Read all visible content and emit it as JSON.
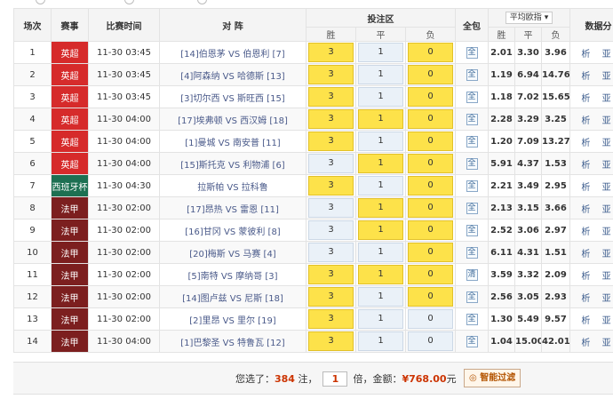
{
  "colors": {
    "epl": "#d62b2b",
    "copa": "#1d7052",
    "ligue1": "#7c1f1f",
    "selected": "#fde24a"
  },
  "header": {
    "col_no": "场次",
    "col_league": "赛事",
    "col_time": "比赛时间",
    "col_match": "对 阵",
    "col_bet": "投注区",
    "col_all": "全包",
    "col_odds": "平均欧指",
    "col_data": "数据分",
    "sub": [
      "胜",
      "平",
      "负",
      "胜",
      "平",
      "负"
    ]
  },
  "rows": [
    {
      "no": "1",
      "league": "英超",
      "lc": "epl",
      "time": "11-30 03:45",
      "home": "[14]伯恩茅",
      "away": "伯恩利 [7]",
      "w": "3",
      "d": "1",
      "l": "0",
      "sel": [
        1,
        0,
        1
      ],
      "pk": "全",
      "o": [
        "2.01",
        "3.30",
        "3.96"
      ],
      "links": "析 亚 "
    },
    {
      "no": "2",
      "league": "英超",
      "lc": "epl",
      "time": "11-30 03:45",
      "home": "[4]阿森纳",
      "away": "哈德斯 [13]",
      "w": "3",
      "d": "1",
      "l": "0",
      "sel": [
        1,
        0,
        1
      ],
      "pk": "全",
      "o": [
        "1.19",
        "6.94",
        "14.76"
      ],
      "links": "析 亚 "
    },
    {
      "no": "3",
      "league": "英超",
      "lc": "epl",
      "time": "11-30 03:45",
      "home": "[3]切尔西",
      "away": "斯旺西 [15]",
      "w": "3",
      "d": "1",
      "l": "0",
      "sel": [
        1,
        0,
        1
      ],
      "pk": "全",
      "o": [
        "1.18",
        "7.02",
        "15.65"
      ],
      "links": "析 亚 "
    },
    {
      "no": "4",
      "league": "英超",
      "lc": "epl",
      "time": "11-30 04:00",
      "home": "[17]埃弗顿",
      "away": "西汉姆 [18]",
      "w": "3",
      "d": "1",
      "l": "0",
      "sel": [
        1,
        1,
        1
      ],
      "pk": "全",
      "o": [
        "2.28",
        "3.29",
        "3.25"
      ],
      "links": "析 亚 "
    },
    {
      "no": "5",
      "league": "英超",
      "lc": "epl",
      "time": "11-30 04:00",
      "home": "[1]曼城",
      "away": "南安普 [11]",
      "w": "3",
      "d": "1",
      "l": "0",
      "sel": [
        1,
        0,
        1
      ],
      "pk": "全",
      "o": [
        "1.20",
        "7.09",
        "13.27"
      ],
      "links": "析 亚 "
    },
    {
      "no": "6",
      "league": "英超",
      "lc": "epl",
      "time": "11-30 04:00",
      "home": "[15]斯托克",
      "away": "利物浦 [6]",
      "w": "3",
      "d": "1",
      "l": "0",
      "sel": [
        0,
        1,
        1
      ],
      "pk": "全",
      "o": [
        "5.91",
        "4.37",
        "1.53"
      ],
      "links": "析 亚 "
    },
    {
      "no": "7",
      "league": "西班牙杯",
      "lc": "copa",
      "time": "11-30 04:30",
      "home": "拉斯帕",
      "away": "拉科鲁",
      "w": "3",
      "d": "1",
      "l": "0",
      "sel": [
        1,
        0,
        1
      ],
      "pk": "全",
      "o": [
        "2.21",
        "3.49",
        "2.95"
      ],
      "links": "析 亚 "
    },
    {
      "no": "8",
      "league": "法甲",
      "lc": "ligue1",
      "time": "11-30 02:00",
      "home": "[17]昂热",
      "away": "雷恩 [11]",
      "w": "3",
      "d": "1",
      "l": "0",
      "sel": [
        0,
        1,
        1
      ],
      "pk": "全",
      "o": [
        "2.13",
        "3.15",
        "3.66"
      ],
      "links": "析 亚 "
    },
    {
      "no": "9",
      "league": "法甲",
      "lc": "ligue1",
      "time": "11-30 02:00",
      "home": "[16]甘冈",
      "away": "蒙彼利 [8]",
      "w": "3",
      "d": "1",
      "l": "0",
      "sel": [
        0,
        1,
        1
      ],
      "pk": "全",
      "o": [
        "2.52",
        "3.06",
        "2.97"
      ],
      "links": "析 亚 "
    },
    {
      "no": "10",
      "league": "法甲",
      "lc": "ligue1",
      "time": "11-30 02:00",
      "home": "[20]梅斯",
      "away": "马赛 [4]",
      "w": "3",
      "d": "1",
      "l": "0",
      "sel": [
        0,
        0,
        1
      ],
      "pk": "全",
      "o": [
        "6.11",
        "4.31",
        "1.51"
      ],
      "links": "析 亚 "
    },
    {
      "no": "11",
      "league": "法甲",
      "lc": "ligue1",
      "time": "11-30 02:00",
      "home": "[5]南特",
      "away": "摩纳哥 [3]",
      "w": "3",
      "d": "1",
      "l": "0",
      "sel": [
        1,
        1,
        1
      ],
      "pk": "清",
      "o": [
        "3.59",
        "3.32",
        "2.09"
      ],
      "links": "析 亚 "
    },
    {
      "no": "12",
      "league": "法甲",
      "lc": "ligue1",
      "time": "11-30 02:00",
      "home": "[14]图卢兹",
      "away": "尼斯 [18]",
      "w": "3",
      "d": "1",
      "l": "0",
      "sel": [
        1,
        0,
        1
      ],
      "pk": "全",
      "o": [
        "2.56",
        "3.05",
        "2.93"
      ],
      "links": "析 亚 "
    },
    {
      "no": "13",
      "league": "法甲",
      "lc": "ligue1",
      "time": "11-30 02:00",
      "home": "[2]里昂",
      "away": "里尔 [19]",
      "w": "3",
      "d": "1",
      "l": "0",
      "sel": [
        1,
        0,
        0
      ],
      "pk": "全",
      "o": [
        "1.30",
        "5.49",
        "9.57"
      ],
      "links": "析 亚 "
    },
    {
      "no": "14",
      "league": "法甲",
      "lc": "ligue1",
      "time": "11-30 04:00",
      "home": "[1]巴黎圣",
      "away": "特鲁瓦 [12]",
      "w": "3",
      "d": "1",
      "l": "0",
      "sel": [
        1,
        0,
        0
      ],
      "pk": "全",
      "o": [
        "1.04",
        "15.00",
        "42.01"
      ],
      "links": "析 亚 "
    }
  ],
  "footer": {
    "prefix": "您选了：",
    "count": "384",
    "unit_zhu": "注，",
    "multiple": "1",
    "unit_bei": "倍，金额：",
    "amount": "¥768.00",
    "unit_yuan": "元",
    "filter_label": "智能过滤"
  }
}
